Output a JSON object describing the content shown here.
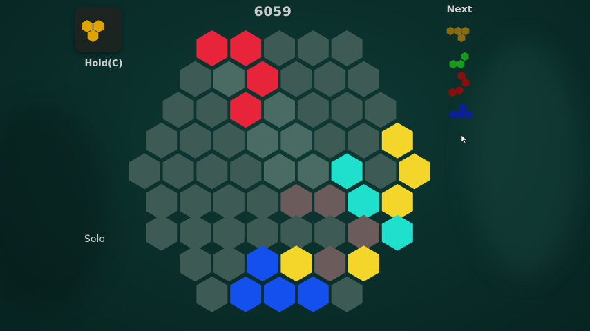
{
  "score": "6059",
  "hold": {
    "label": "Hold(C)",
    "piece_color": "#e0a400",
    "piece_icon": "triangle-tri-hex-icon"
  },
  "next": {
    "label": "Next",
    "pieces": [
      {
        "color": "#8a6a10",
        "icon": "next-piece-1-icon"
      },
      {
        "color": "#1a9a1a",
        "icon": "next-piece-2-icon"
      },
      {
        "color": "#8a0e0e",
        "icon": "next-piece-3-icon"
      },
      {
        "color": "#0c1e9a",
        "icon": "next-piece-4-icon"
      }
    ]
  },
  "mode": "Solo",
  "colors": {
    "empty_light": "#4a6b64",
    "empty": "#3e5a55",
    "red": "#e8243a",
    "yellow": "#f4d62a",
    "cyan": "#1fe0cc",
    "brown": "#6b5b5b",
    "blue": "#1450ee"
  },
  "board": {
    "rows": [
      [
        "red",
        "red",
        "empty",
        "empty",
        "empty"
      ],
      [
        "empty",
        "empty_light",
        "red",
        "empty",
        "empty",
        "empty"
      ],
      [
        "empty",
        "empty",
        "red",
        "empty_light",
        "empty",
        "empty",
        "empty"
      ],
      [
        "empty",
        "empty",
        "empty",
        "empty_light",
        "empty_light",
        "empty",
        "empty",
        "yellow"
      ],
      [
        "empty",
        "empty",
        "empty",
        "empty",
        "empty_light",
        "empty_light",
        "cyan",
        "empty",
        "yellow"
      ],
      [
        "empty",
        "empty",
        "empty",
        "empty",
        "brown",
        "brown",
        "cyan",
        "yellow"
      ],
      [
        "empty",
        "empty",
        "empty",
        "empty",
        "empty",
        "empty",
        "brown",
        "cyan"
      ],
      [
        "empty",
        "empty",
        "blue",
        "yellow",
        "brown",
        "yellow"
      ],
      [
        "empty",
        "blue",
        "blue",
        "blue",
        "empty"
      ]
    ]
  }
}
